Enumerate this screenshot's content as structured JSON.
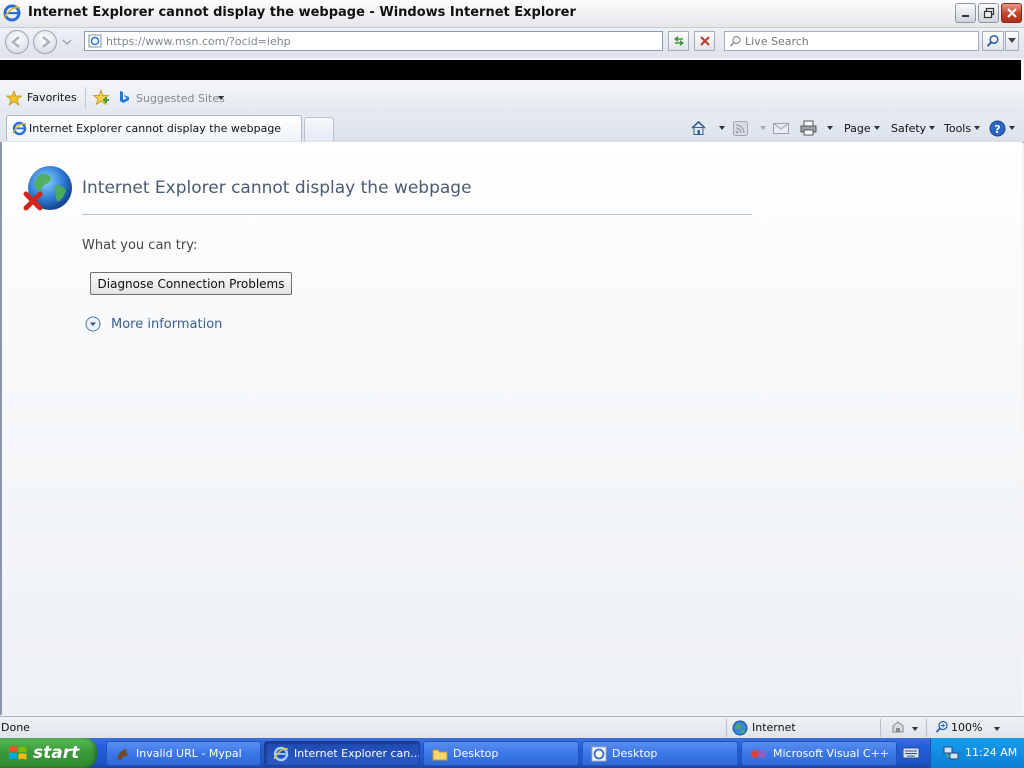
{
  "window": {
    "title": "Internet Explorer cannot display the webpage - Windows Internet Explorer"
  },
  "address_bar": {
    "url": "https://www.msn.com/?ocid=iehp",
    "search_placeholder": "Live Search"
  },
  "favorites_bar": {
    "favorites_label": "Favorites",
    "suggested_sites_label": "Suggested Sites"
  },
  "tabs": [
    {
      "label": "Internet Explorer cannot display the webpage"
    }
  ],
  "command_bar": {
    "page_label": "Page",
    "safety_label": "Safety",
    "tools_label": "Tools"
  },
  "content": {
    "title": "Internet Explorer cannot display the webpage",
    "try_label": "What you can try:",
    "diagnose_button": "Diagnose Connection Problems",
    "more_info_label": "More information"
  },
  "status_bar": {
    "status": "Done",
    "zone": "Internet",
    "zoom": "100%"
  },
  "taskbar": {
    "start_label": "start",
    "items": [
      {
        "label": "Invalid URL - Mypal"
      },
      {
        "label": "Internet Explorer can..."
      },
      {
        "label": "Desktop"
      },
      {
        "label": "Desktop"
      },
      {
        "label": "Microsoft Visual C++"
      }
    ],
    "clock": "11:24 AM"
  },
  "colors": {
    "title_text": "#4a5a70",
    "link": "#3b5f8c",
    "taskbar": "#245edb",
    "start_button": "#3a9a3a"
  }
}
